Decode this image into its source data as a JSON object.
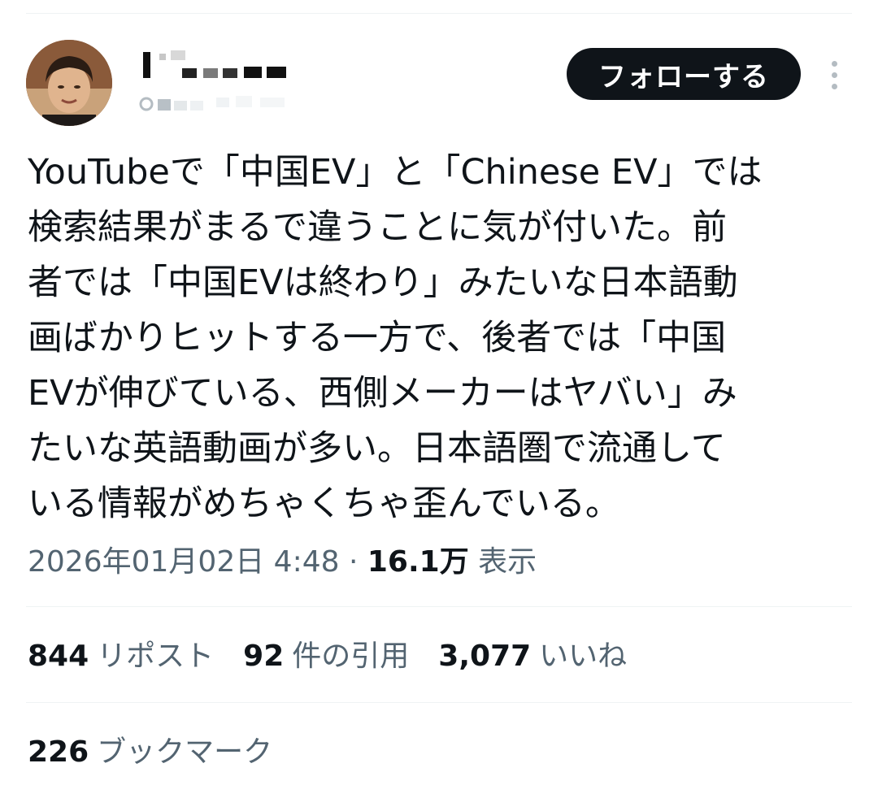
{
  "header": {
    "follow_label": "フォローする"
  },
  "tweet": {
    "lines": [
      "YouTubeで「中国EV」と「Chinese EV」では",
      "検索結果がまるで違うことに気が付いた。前",
      "者では「中国EVは終わり」みたいな日本語動",
      "画ばかりヒットする一方で、後者では「中国",
      "EVが伸びている、西側メーカーはヤバい」み",
      "たいな英語動画が多い。日本語圏で流通して",
      "いる情報がめちゃくちゃ歪んでいる。"
    ]
  },
  "meta": {
    "datetime": "2026年01月02日 4:48",
    "separator": " · ",
    "views_count": "16.1万",
    "views_label": "表示"
  },
  "stats": {
    "reposts_count": "844",
    "reposts_label": "リポスト",
    "quotes_count": "92",
    "quotes_label": "件の引用",
    "likes_count": "3,077",
    "likes_label": "いいね",
    "bookmarks_count": "226",
    "bookmarks_label": "ブックマーク"
  },
  "colors": {
    "text_primary": "#0f1419",
    "text_secondary": "#536471",
    "button_bg": "#0f1419",
    "button_text": "#ffffff",
    "divider": "#eff3f4"
  },
  "icons": {
    "more": "vertical-ellipsis-icon"
  }
}
